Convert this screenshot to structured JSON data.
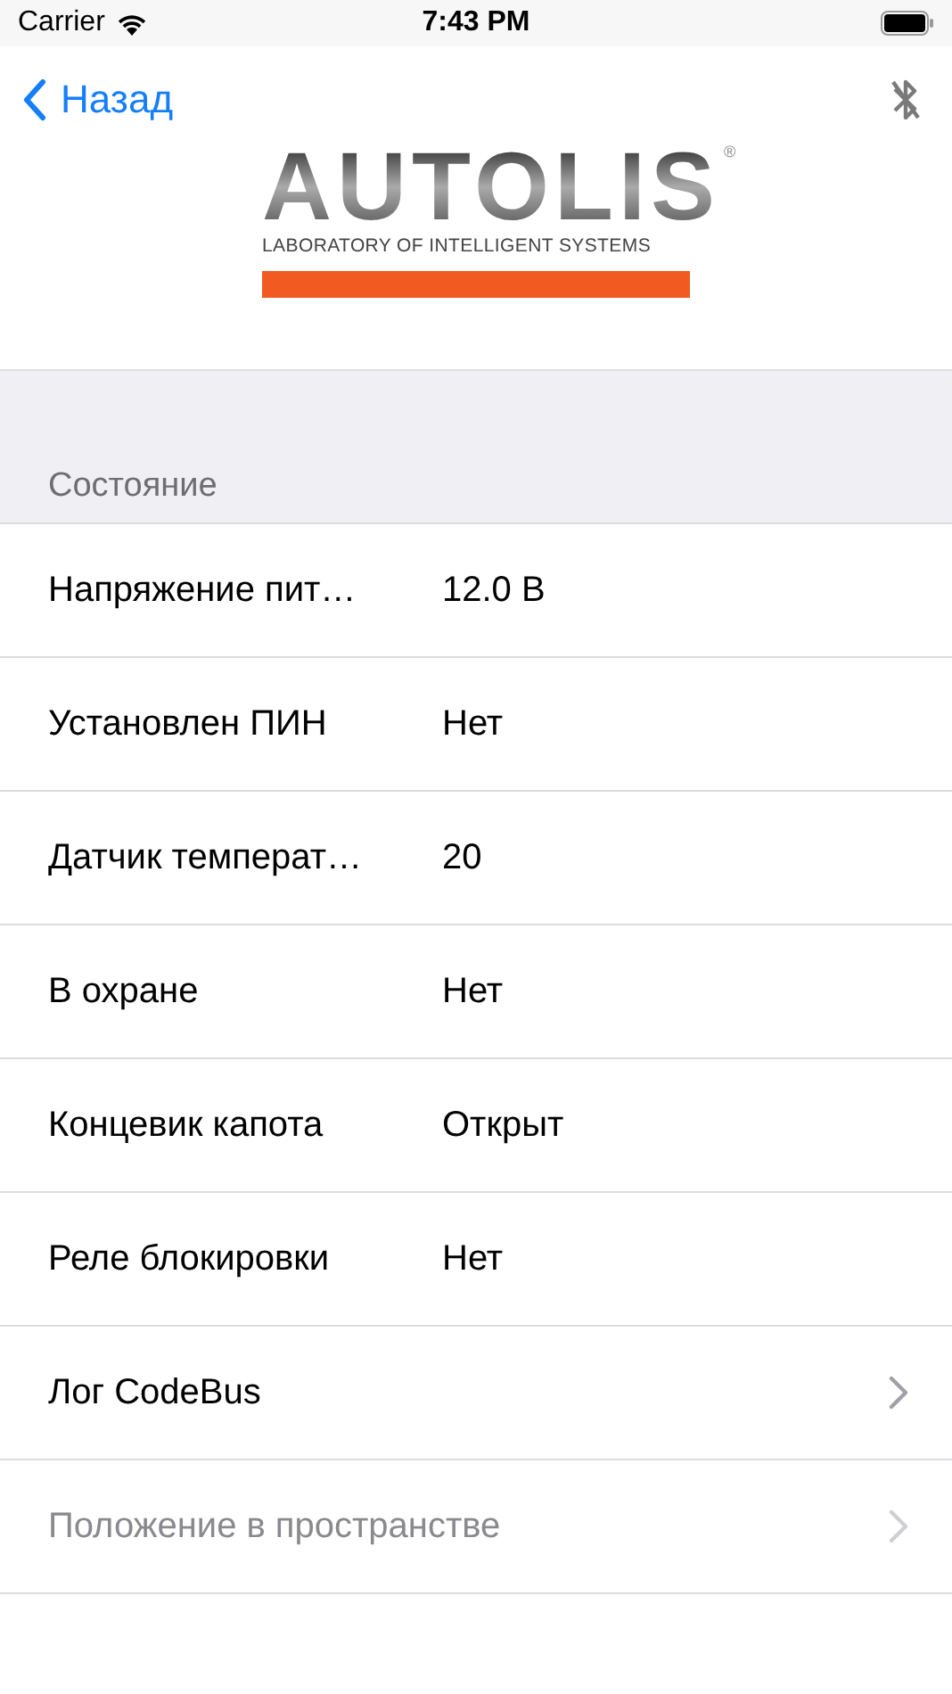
{
  "status_bar": {
    "carrier": "Carrier",
    "time": "7:43 PM"
  },
  "nav": {
    "back": "Назад",
    "bluetooth_connected": false
  },
  "logo": {
    "name": "AUTOLIS",
    "mark": "®",
    "tagline": "LABORATORY OF INTELLIGENT SYSTEMS"
  },
  "section": {
    "header": "Состояние"
  },
  "rows": [
    {
      "kind": "value",
      "label": "Напряжение пит…",
      "value": "12.0 В",
      "disabled": false
    },
    {
      "kind": "value",
      "label": "Установлен ПИН",
      "value": "Нет",
      "disabled": false
    },
    {
      "kind": "value",
      "label": "Датчик температ…",
      "value": "20",
      "disabled": false
    },
    {
      "kind": "value",
      "label": "В охране",
      "value": "Нет",
      "disabled": false
    },
    {
      "kind": "value",
      "label": "Концевик капота",
      "value": "Открыт",
      "disabled": false
    },
    {
      "kind": "value",
      "label": "Реле блокировки",
      "value": "Нет",
      "disabled": false
    },
    {
      "kind": "link",
      "label": "Лог CodeBus",
      "disabled": false
    },
    {
      "kind": "link",
      "label": "Положение в пространстве",
      "disabled": true
    }
  ]
}
